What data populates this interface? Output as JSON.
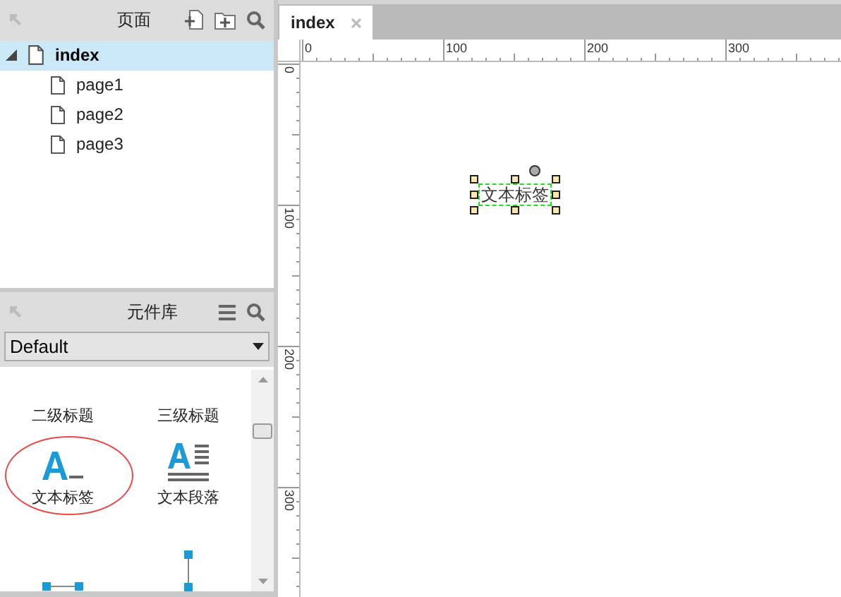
{
  "pages_panel": {
    "title": "页面",
    "tree": [
      {
        "label": "index",
        "expanded": true,
        "selected": true,
        "children": [
          {
            "label": "page1",
            "selected": false
          },
          {
            "label": "page2",
            "selected": false
          },
          {
            "label": "page3",
            "selected": false
          }
        ]
      }
    ]
  },
  "library_panel": {
    "title": "元件库",
    "dropdown": {
      "value": "Default"
    },
    "items": [
      {
        "kind": "heading",
        "label": "二级标题",
        "circled": false
      },
      {
        "kind": "heading",
        "label": "三级标题",
        "circled": false
      },
      {
        "kind": "label",
        "label": "文本标签",
        "circled": true
      },
      {
        "kind": "paragraph",
        "label": "文本段落",
        "circled": false
      },
      {
        "kind": "hline",
        "circled": false
      },
      {
        "kind": "vline",
        "circled": false
      }
    ]
  },
  "editor": {
    "tabs": [
      {
        "label": "index",
        "selected": true
      }
    ],
    "ruler": {
      "x_labels": [
        "0",
        "100",
        "200",
        "300"
      ],
      "y_labels": [
        "0",
        "100",
        "200",
        "300"
      ]
    },
    "canvas": {
      "widgets": [
        {
          "text": "文本标签",
          "selected": true
        }
      ]
    }
  }
}
